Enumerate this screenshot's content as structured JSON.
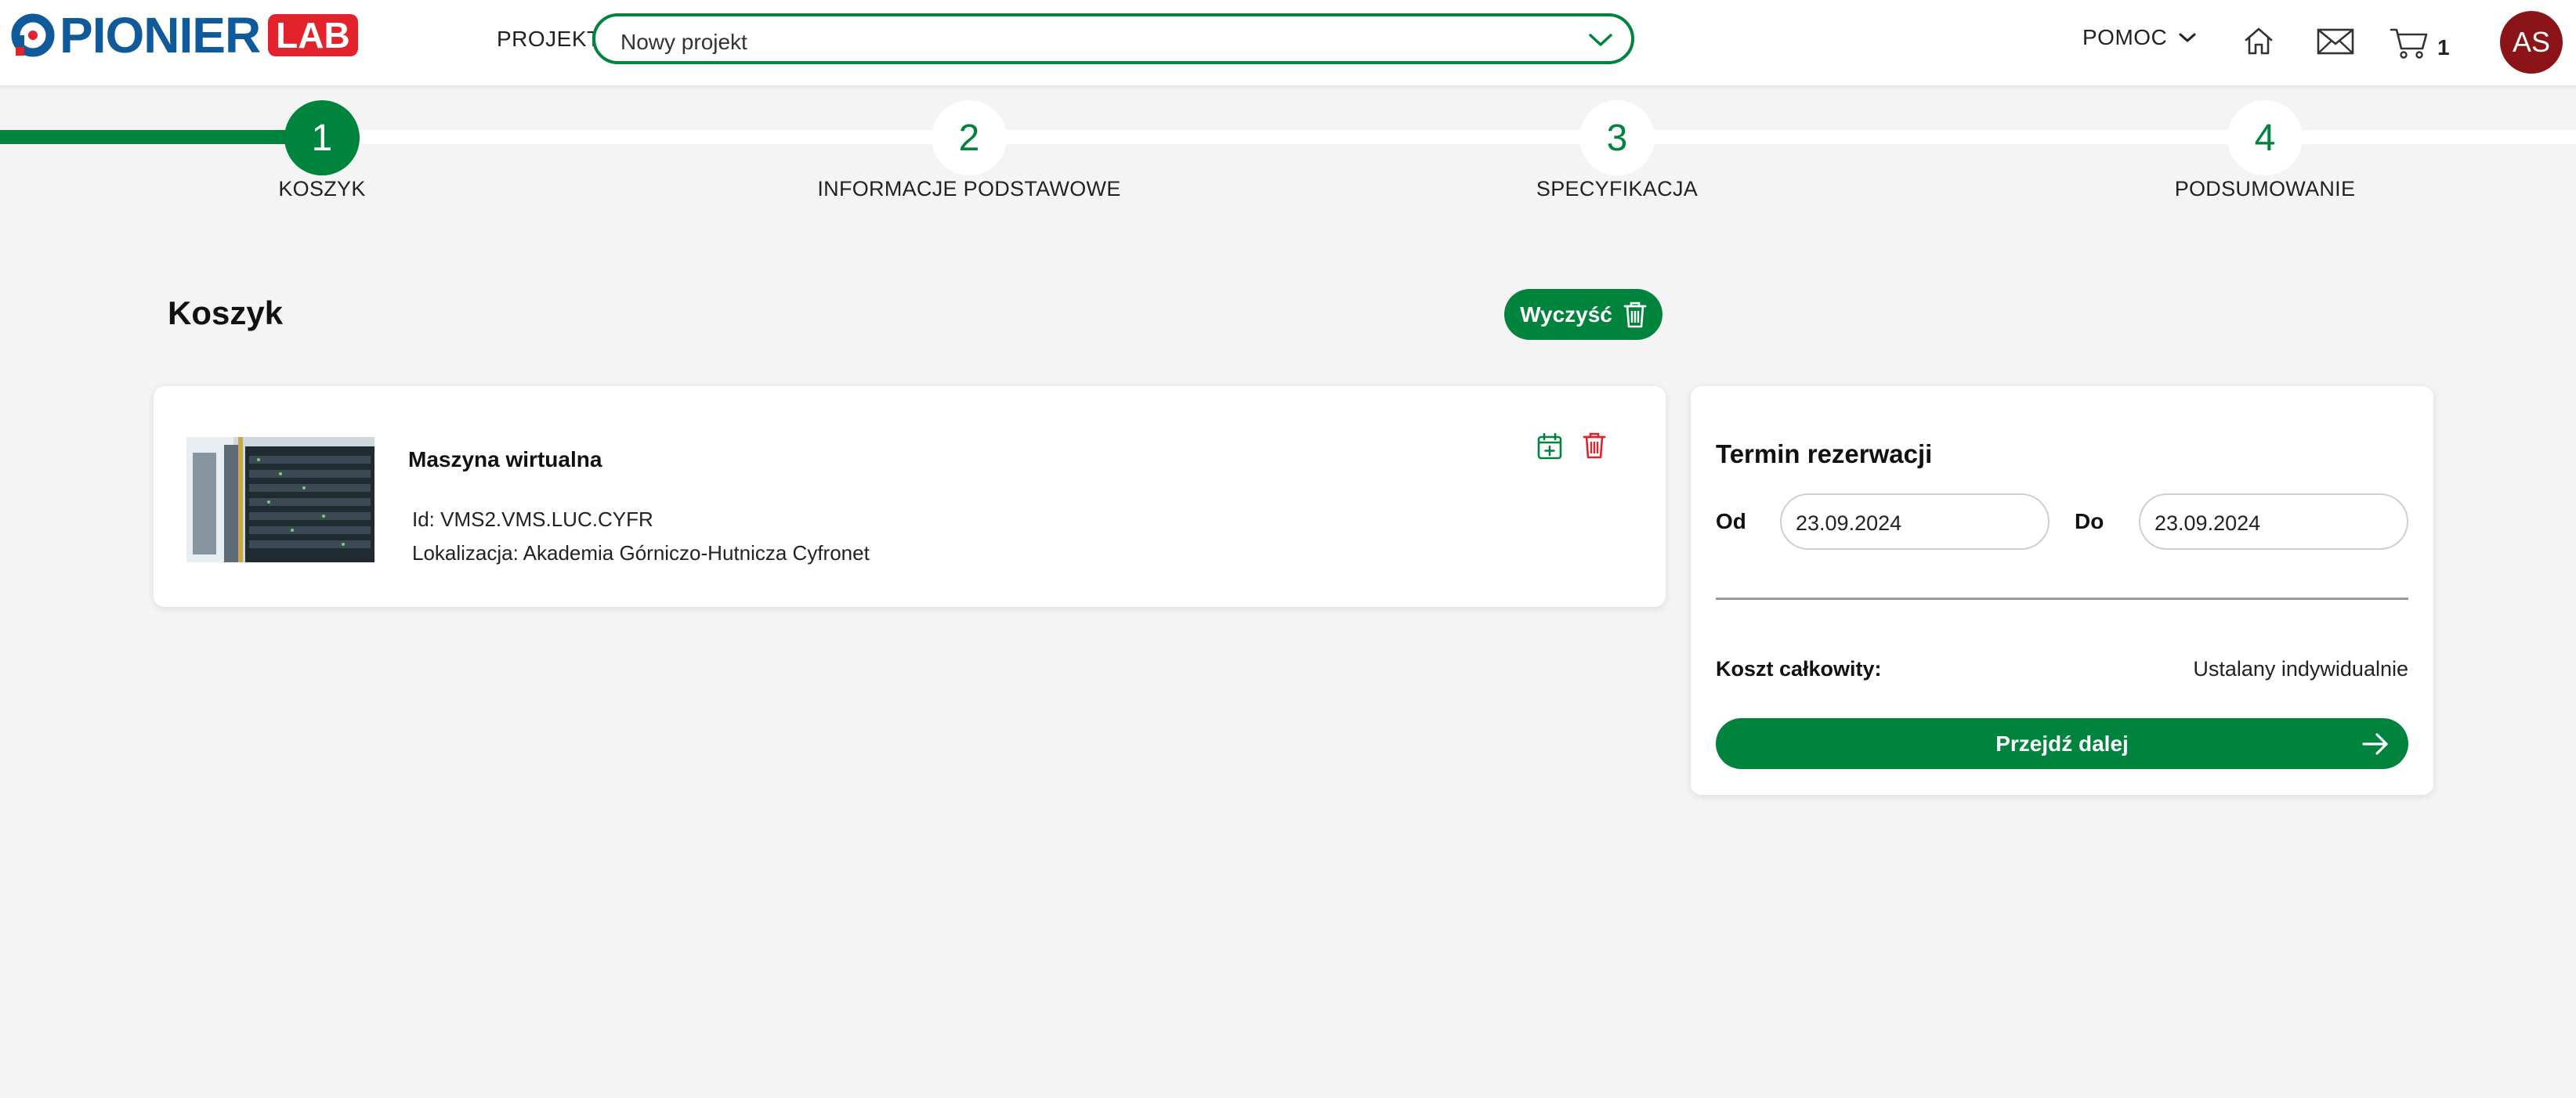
{
  "header": {
    "logo_text": "PIONIER",
    "logo_badge": "LAB",
    "projekt_label": "PROJEKT",
    "projekt_value": "Nowy projekt",
    "help_label": "POMOC",
    "cart_count": "1",
    "avatar_initials": "AS"
  },
  "stepper": {
    "steps": [
      {
        "number": "1",
        "label": "KOSZYK",
        "active": true
      },
      {
        "number": "2",
        "label": "INFORMACJE PODSTAWOWE",
        "active": false
      },
      {
        "number": "3",
        "label": "SPECYFIKACJA",
        "active": false
      },
      {
        "number": "4",
        "label": "PODSUMOWANIE",
        "active": false
      }
    ]
  },
  "cart": {
    "title": "Koszyk",
    "clear_label": "Wyczyść",
    "items": [
      {
        "name": "Maszyna wirtualna",
        "id_text": "Id: VMS2.VMS.LUC.CYFR",
        "location_text": "Lokalizacja: Akademia Górniczo-Hutnicza Cyfronet"
      }
    ]
  },
  "reservation": {
    "title": "Termin rezerwacji",
    "from_label": "Od",
    "from_value": "23.09.2024",
    "to_label": "Do",
    "to_value": "23.09.2024",
    "cost_label": "Koszt całkowity:",
    "cost_value": "Ustalany indywidualnie",
    "next_label": "Przejdź dalej"
  },
  "colors": {
    "accent": "#00843d",
    "brand_blue": "#0f5a9b",
    "brand_red": "#e3232b",
    "avatar_bg": "#8a1418",
    "danger": "#e3232b",
    "background": "#f4f4f4"
  },
  "icons": [
    "chevron-down-icon",
    "home-icon",
    "mail-icon",
    "cart-icon",
    "trash-icon",
    "calendar-add-icon",
    "arrow-right-icon"
  ]
}
